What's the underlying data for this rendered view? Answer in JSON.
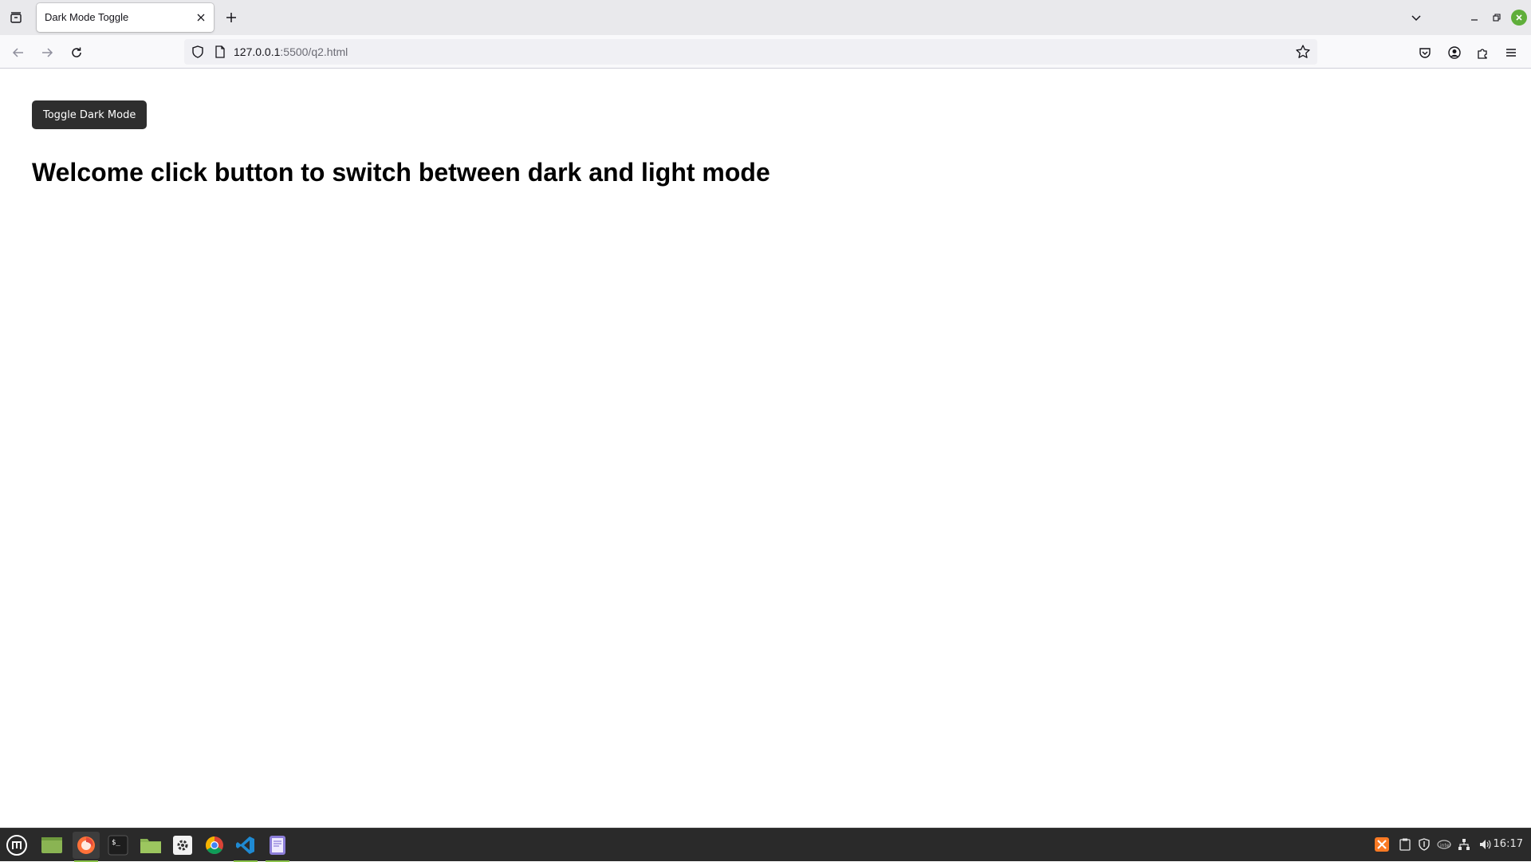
{
  "browser": {
    "tab": {
      "title": "Dark Mode Toggle"
    },
    "url": {
      "host": "127.0.0.1",
      "rest": ":5500/q2.html"
    }
  },
  "page": {
    "toggle_button_label": "Toggle Dark Mode",
    "heading": "Welcome click button to switch between dark and light mode"
  },
  "taskbar": {
    "apps": [
      "menu-icon",
      "desktop-icon",
      "firefox-icon",
      "terminal-icon",
      "files-icon",
      "settings-icon",
      "chrome-icon",
      "vscode-icon",
      "text-editor-icon"
    ],
    "tray": [
      "xampp-icon",
      "clipboard-icon",
      "shield-icon",
      "network-card-icon",
      "network-icon",
      "volume-icon"
    ],
    "clock": "16:17"
  },
  "colors": {
    "button_bg": "#2e2e2e",
    "taskbar_bg": "#2a2a2a",
    "active_indicator": "#8bc34a",
    "window_close": "#5fae3a"
  }
}
